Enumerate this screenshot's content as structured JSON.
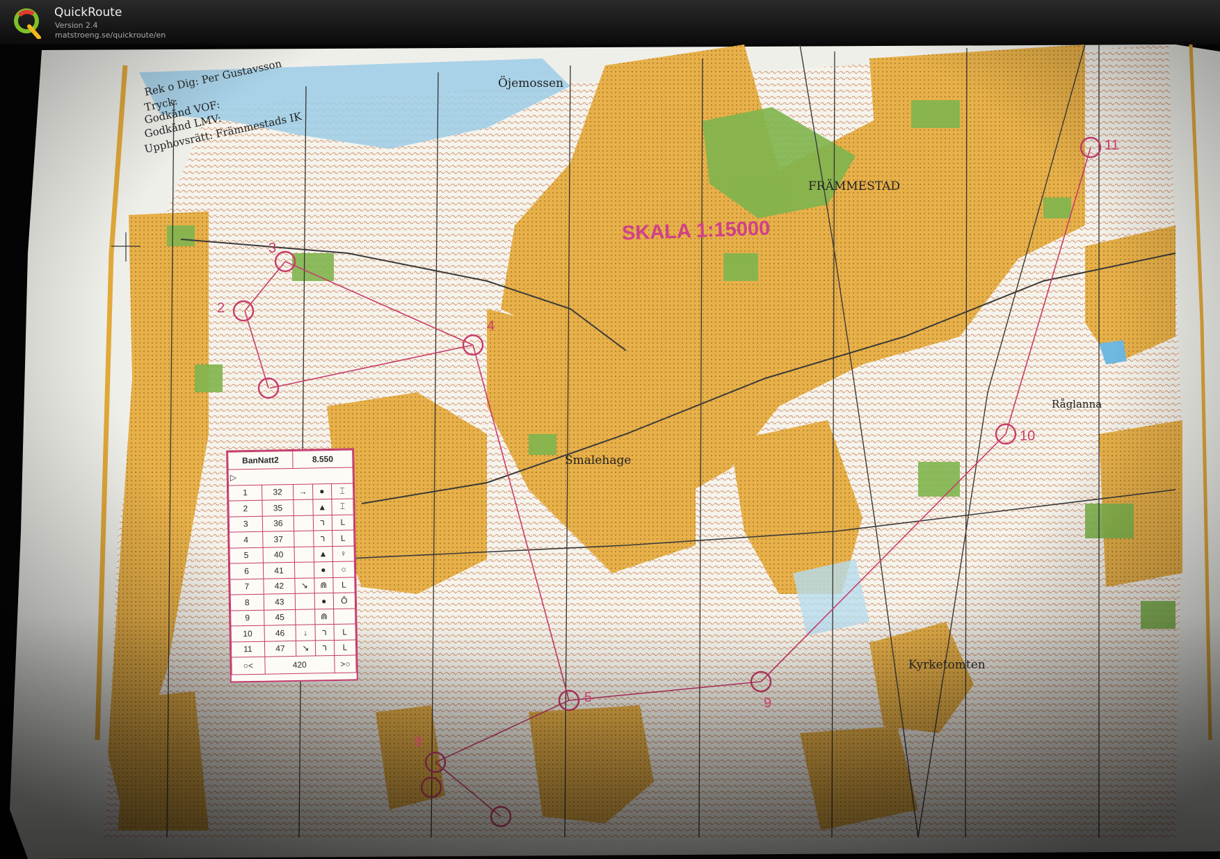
{
  "app": {
    "name": "QuickRoute",
    "version": "Version 2.4",
    "url": "matstroeng.se/quickroute/en"
  },
  "map": {
    "credits": [
      "Rek o Dig: Per Gustavsson",
      "Tryck:",
      "Godkänd VOF:",
      "Godkänd LMV:",
      "Upphovsrätt: Främmestads IK"
    ],
    "place_names": {
      "ojemossen": "Öjemossen",
      "frammestad": "FRÄMMESTAD",
      "smalehage": "Smalehage",
      "raglanna": "Råglanna",
      "kyrketomten": "Kyrketomten"
    },
    "scale_label": "SKALA 1:15000",
    "controls": [
      {
        "num": "2"
      },
      {
        "num": "3"
      },
      {
        "num": "4"
      },
      {
        "num": "5"
      },
      {
        "num": "8"
      },
      {
        "num": "9"
      },
      {
        "num": "10"
      },
      {
        "num": "11"
      }
    ],
    "colors": {
      "open_land": "#e8b24a",
      "forest": "#f4f4ee",
      "green": "#7bb24c",
      "water": "#8ec9e6",
      "course": "#c83c6c"
    }
  },
  "control_description": {
    "course": "BanNatt2",
    "length": "8.550",
    "rows": [
      {
        "n": "1",
        "code": "32",
        "sym1": "→",
        "sym2": "●",
        "sym3": "⌶"
      },
      {
        "n": "2",
        "code": "35",
        "sym1": "",
        "sym2": "▲",
        "sym3": "⌶"
      },
      {
        "n": "3",
        "code": "36",
        "sym1": "",
        "sym2": "ﬧ",
        "sym3": "L"
      },
      {
        "n": "4",
        "code": "37",
        "sym1": "",
        "sym2": "ﬧ",
        "sym3": "L"
      },
      {
        "n": "5",
        "code": "40",
        "sym1": "",
        "sym2": "▲",
        "sym3": "♀"
      },
      {
        "n": "6",
        "code": "41",
        "sym1": "",
        "sym2": "●",
        "sym3": "○"
      },
      {
        "n": "7",
        "code": "42",
        "sym1": "↘",
        "sym2": "⋒",
        "sym3": "L"
      },
      {
        "n": "8",
        "code": "43",
        "sym1": "",
        "sym2": "●",
        "sym3": "Ô"
      },
      {
        "n": "9",
        "code": "45",
        "sym1": "",
        "sym2": "⋒",
        "sym3": ""
      },
      {
        "n": "10",
        "code": "46",
        "sym1": "↓",
        "sym2": "ﬧ",
        "sym3": "L"
      },
      {
        "n": "11",
        "code": "47",
        "sym1": "↘",
        "sym2": "ﬧ",
        "sym3": "L"
      }
    ],
    "finish_distance": "420"
  }
}
